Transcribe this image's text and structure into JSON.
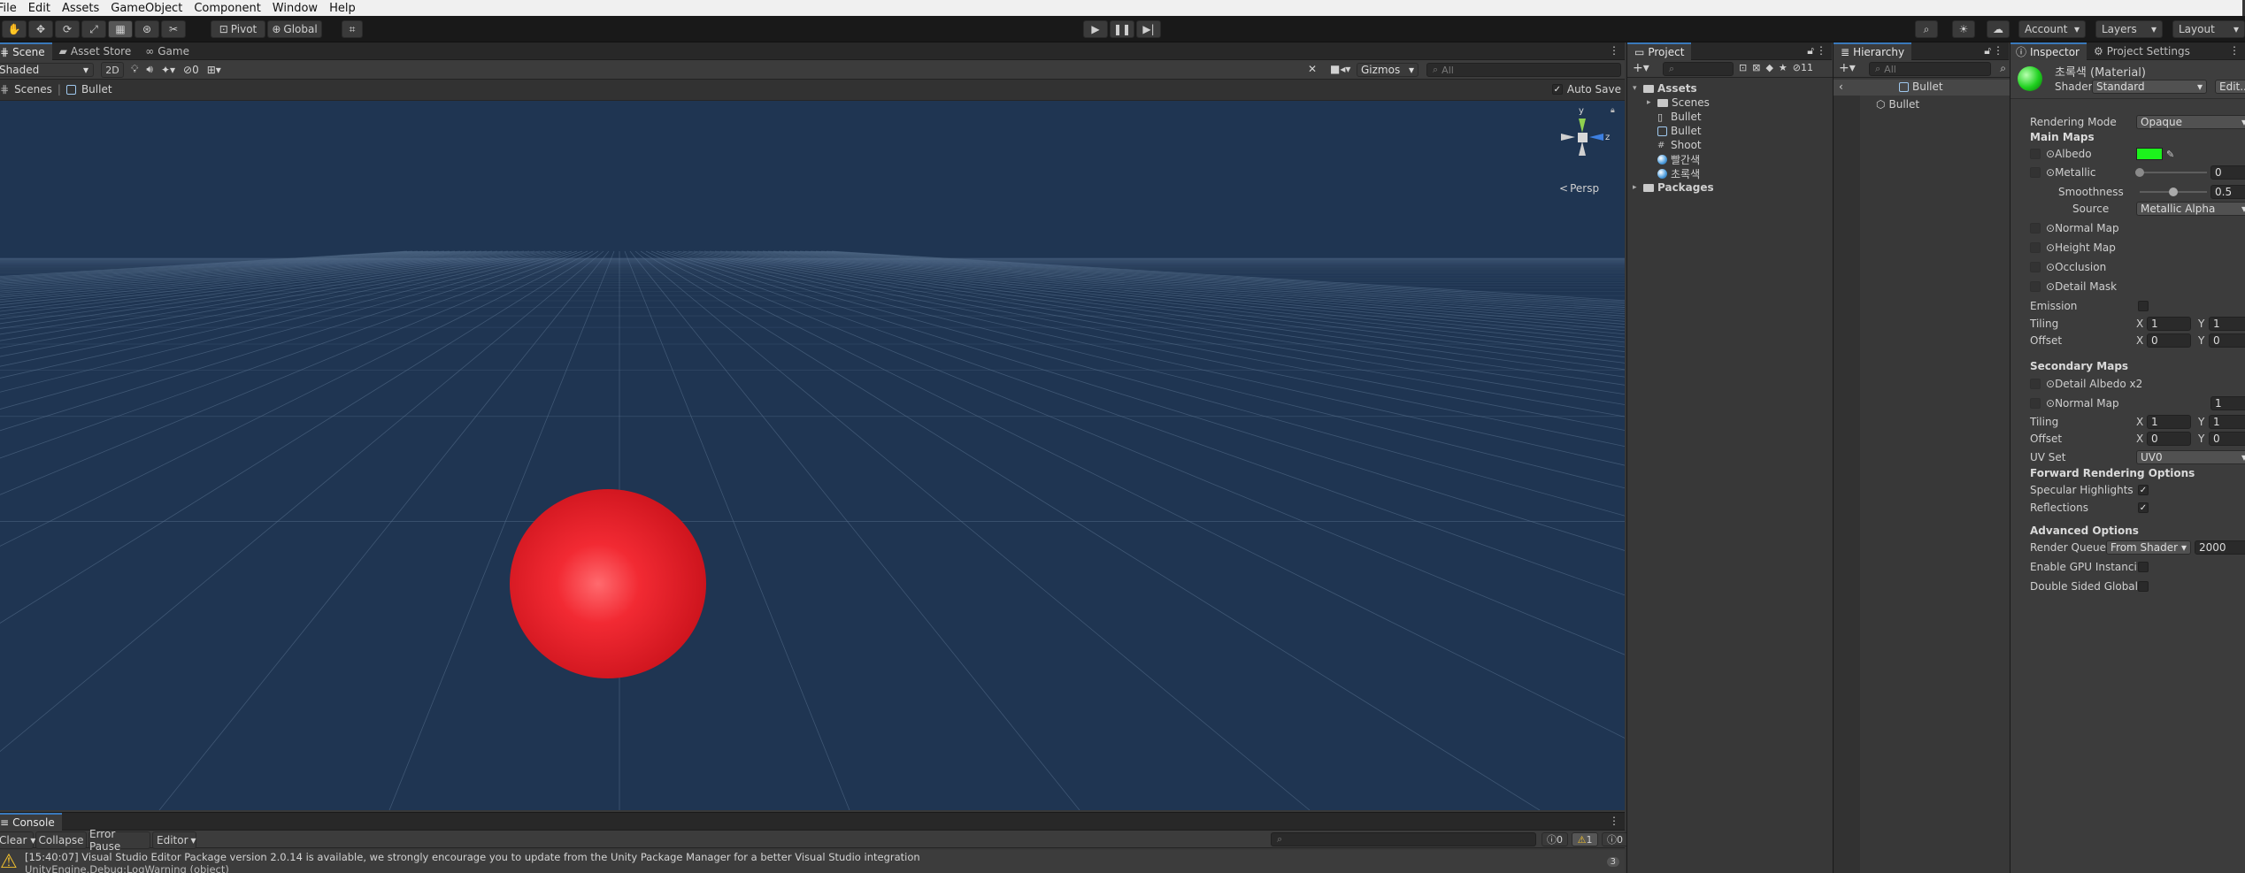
{
  "menubar": [
    "File",
    "Edit",
    "Assets",
    "GameObject",
    "Component",
    "Window",
    "Help"
  ],
  "toolbar": {
    "pivot_label": "Pivot",
    "global_label": "Global",
    "account_label": "Account",
    "layers_label": "Layers",
    "layout_label": "Layout"
  },
  "scene": {
    "tabs": [
      "Scene",
      "Asset Store",
      "Game"
    ],
    "shading_mode": "Shaded",
    "toggle_2d": "2D",
    "hidden_count": "0",
    "gizmos_label": "Gizmos",
    "search_placeholder": "All",
    "breadcrumb_root": "Scenes",
    "breadcrumb_current": "Bullet",
    "auto_save_label": "Auto Save",
    "persp_label": "Persp",
    "axis_y": "y",
    "axis_z": "z",
    "sky_color": "#1f3552",
    "sphere_color": "#e8212b"
  },
  "project": {
    "tab": "Project",
    "hidden_count": "11",
    "items": [
      {
        "label": "Assets",
        "level": 0,
        "icon": "folder-open-icon",
        "bold": true
      },
      {
        "label": "Scenes",
        "level": 1,
        "icon": "folder-icon",
        "bold": false
      },
      {
        "label": "Bullet",
        "level": 1,
        "icon": "file-icon",
        "bold": false
      },
      {
        "label": "Bullet",
        "level": 1,
        "icon": "unity-scene-icon",
        "bold": false
      },
      {
        "label": "Shoot",
        "level": 1,
        "icon": "script-icon",
        "bold": false
      },
      {
        "label": "빨간색",
        "level": 1,
        "icon": "material-icon",
        "bold": false
      },
      {
        "label": "초록색",
        "level": 1,
        "icon": "material-icon",
        "bold": false
      },
      {
        "label": "Packages",
        "level": 0,
        "icon": "folder-icon",
        "bold": true
      }
    ]
  },
  "hierarchy": {
    "tab": "Hierarchy",
    "search_placeholder": "All",
    "scene_name": "Bullet",
    "objects": [
      "Bullet"
    ]
  },
  "inspector": {
    "tabs": [
      "Inspector",
      "Project Settings"
    ],
    "material_name": "초록색 (Material)",
    "shader_label": "Shader",
    "shader_value": "Standard",
    "edit_label": "Edit...",
    "rendering_mode_label": "Rendering Mode",
    "rendering_mode_value": "Opaque",
    "main_maps_label": "Main Maps",
    "albedo_label": "Albedo",
    "albedo_color": "#1cf21c",
    "metallic_label": "Metallic",
    "metallic_value": "0",
    "metallic_fraction": 0.0,
    "smoothness_label": "Smoothness",
    "smoothness_value": "0.5",
    "smoothness_fraction": 0.5,
    "source_label": "Source",
    "source_value": "Metallic Alpha",
    "normal_map_label": "Normal Map",
    "height_map_label": "Height Map",
    "occlusion_label": "Occlusion",
    "detail_mask_label": "Detail Mask",
    "emission_label": "Emission",
    "tiling_label": "Tiling",
    "offset_label": "Offset",
    "x_label": "X",
    "y_label": "Y",
    "tiling_x": "1",
    "tiling_y": "1",
    "offset_x": "0",
    "offset_y": "0",
    "secondary_maps_label": "Secondary Maps",
    "detail_albedo_label": "Detail Albedo x2",
    "secondary_normal_label": "Normal Map",
    "secondary_normal_value": "1",
    "sec_tiling_x": "1",
    "sec_tiling_y": "1",
    "sec_offset_x": "0",
    "sec_offset_y": "0",
    "uv_set_label": "UV Set",
    "uv_set_value": "UV0",
    "forward_label": "Forward Rendering Options",
    "specular_label": "Specular Highlights",
    "reflections_label": "Reflections",
    "advanced_label": "Advanced Options",
    "render_queue_label": "Render Queue",
    "render_queue_source": "From Shader",
    "render_queue_value": "2000",
    "gpu_instancing_label": "Enable GPU Instancir",
    "double_sided_label": "Double Sided Global I"
  },
  "console": {
    "tab": "Console",
    "clear_label": "Clear",
    "collapse_label": "Collapse",
    "error_pause_label": "Error Pause",
    "editor_label": "Editor",
    "info_count": "0",
    "warning_count": "1",
    "error_count": "0",
    "message_line1": "[15:40:07] Visual Studio Editor Package version 2.0.14 is available, we strongly encourage you to update from the Unity Package Manager for a better Visual Studio integration",
    "message_line2": "UnityEngine.Debug:LogWarning (object)",
    "message_count": "3"
  }
}
